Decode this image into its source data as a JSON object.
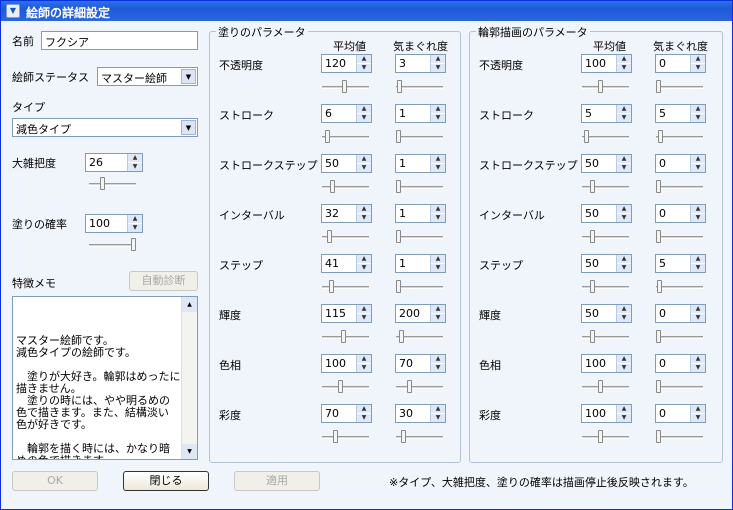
{
  "window": {
    "title": "絵師の詳細設定"
  },
  "left": {
    "name_label": "名前",
    "name_value": "フクシア",
    "status_label": "絵師ステータス",
    "status_value": "マスター絵師",
    "type_label": "タイプ",
    "type_value": "減色タイプ",
    "roughness_label": "大雑把度",
    "roughness_value": "26",
    "roughness_level": 0.26,
    "paint_prob_label": "塗りの確率",
    "paint_prob_value": "100",
    "paint_prob_level": 1.0,
    "memo_label": "特徴メモ",
    "auto_diag_label": "自動診断",
    "memo_lines": [
      "マスター絵師です。",
      "減色タイプの絵師です。",
      "",
      "　塗りが大好き。輪郭はめったに",
      "描きません。",
      "　塗りの時には、やや明るめの",
      "色で描きます。また、結構淡い",
      "色が好きです。",
      "",
      "　輪郭を描く時には、かなり暗",
      "めの色で描きます。"
    ]
  },
  "paint_group": {
    "title": "塗りのパラメータ",
    "col_mean": "平均値",
    "col_var": "気まぐれ度",
    "rows": [
      {
        "label": "不透明度",
        "mean": "120",
        "var": "3",
        "mean_level": 0.47,
        "var_level": 0.03
      },
      {
        "label": "ストローク",
        "mean": "6",
        "var": "1",
        "mean_level": 0.06,
        "var_level": 0.01
      },
      {
        "label": "ストロークステップ",
        "mean": "50",
        "var": "1",
        "mean_level": 0.2,
        "var_level": 0.01
      },
      {
        "label": "インターバル",
        "mean": "32",
        "var": "1",
        "mean_level": 0.13,
        "var_level": 0.01
      },
      {
        "label": "ステップ",
        "mean": "41",
        "var": "1",
        "mean_level": 0.16,
        "var_level": 0.01
      },
      {
        "label": "輝度",
        "mean": "115",
        "var": "200",
        "mean_level": 0.45,
        "var_level": 0.08
      },
      {
        "label": "色相",
        "mean": "100",
        "var": "70",
        "mean_level": 0.39,
        "var_level": 0.27
      },
      {
        "label": "彩度",
        "mean": "70",
        "var": "30",
        "mean_level": 0.27,
        "var_level": 0.12
      }
    ]
  },
  "outline_group": {
    "title": "輪郭描画のパラメータ",
    "col_mean": "平均値",
    "col_var": "気まぐれ度",
    "rows": [
      {
        "label": "不透明度",
        "mean": "100",
        "var": "0",
        "mean_level": 0.39,
        "var_level": 0.0
      },
      {
        "label": "ストローク",
        "mean": "5",
        "var": "5",
        "mean_level": 0.05,
        "var_level": 0.05
      },
      {
        "label": "ストロークステップ",
        "mean": "50",
        "var": "0",
        "mean_level": 0.2,
        "var_level": 0.0
      },
      {
        "label": "インターバル",
        "mean": "50",
        "var": "0",
        "mean_level": 0.2,
        "var_level": 0.0
      },
      {
        "label": "ステップ",
        "mean": "50",
        "var": "5",
        "mean_level": 0.2,
        "var_level": 0.02
      },
      {
        "label": "輝度",
        "mean": "50",
        "var": "0",
        "mean_level": 0.2,
        "var_level": 0.0
      },
      {
        "label": "色相",
        "mean": "100",
        "var": "0",
        "mean_level": 0.39,
        "var_level": 0.0
      },
      {
        "label": "彩度",
        "mean": "100",
        "var": "0",
        "mean_level": 0.39,
        "var_level": 0.0
      }
    ]
  },
  "footer": {
    "ok_label": "OK",
    "close_label": "閉じる",
    "apply_label": "適用",
    "note": "※タイプ、大雑把度、塗りの確率は描画停止後反映されます。"
  },
  "icons": {
    "app": "window-menu-icon",
    "spin_up": "spin-up-icon",
    "spin_down": "spin-down-icon",
    "dropdown": "dropdown-arrow-icon"
  }
}
